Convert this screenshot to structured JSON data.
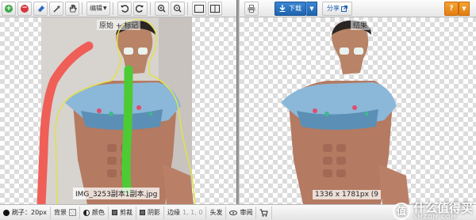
{
  "toolbar_left": {
    "add_icon": "plus-circle-icon",
    "remove_icon": "minus-circle-icon",
    "edit_label": "编辑",
    "colors": {
      "green": "#39a845",
      "red": "#d5373c",
      "blue": "#2b6cc4"
    }
  },
  "toolbar_right": {
    "download_label": "下载",
    "share_label": "分享",
    "help_label": "?",
    "colors": {
      "download": "#2a74c0",
      "help": "#ee8f22"
    }
  },
  "left_pane": {
    "title": "原始 + 标记",
    "filename": "IMG_3253副本1副本.jpg"
  },
  "right_pane": {
    "title": "结果",
    "dimensions": "1336 x 1781px (9"
  },
  "bottombar": {
    "brush_label": "刷子：",
    "brush_size": "20px",
    "background_label": "背景",
    "color_label": "颜色",
    "crop_label": "剪裁",
    "shadow_label": "阴影",
    "edge_label": "边缘",
    "edge_value": "1, 1, 0",
    "hair_label": "头发",
    "review_label": "审阅"
  },
  "watermark": {
    "logo_glyph": "值",
    "text": "什么值得买",
    "domain": "SMZDM.COM"
  }
}
